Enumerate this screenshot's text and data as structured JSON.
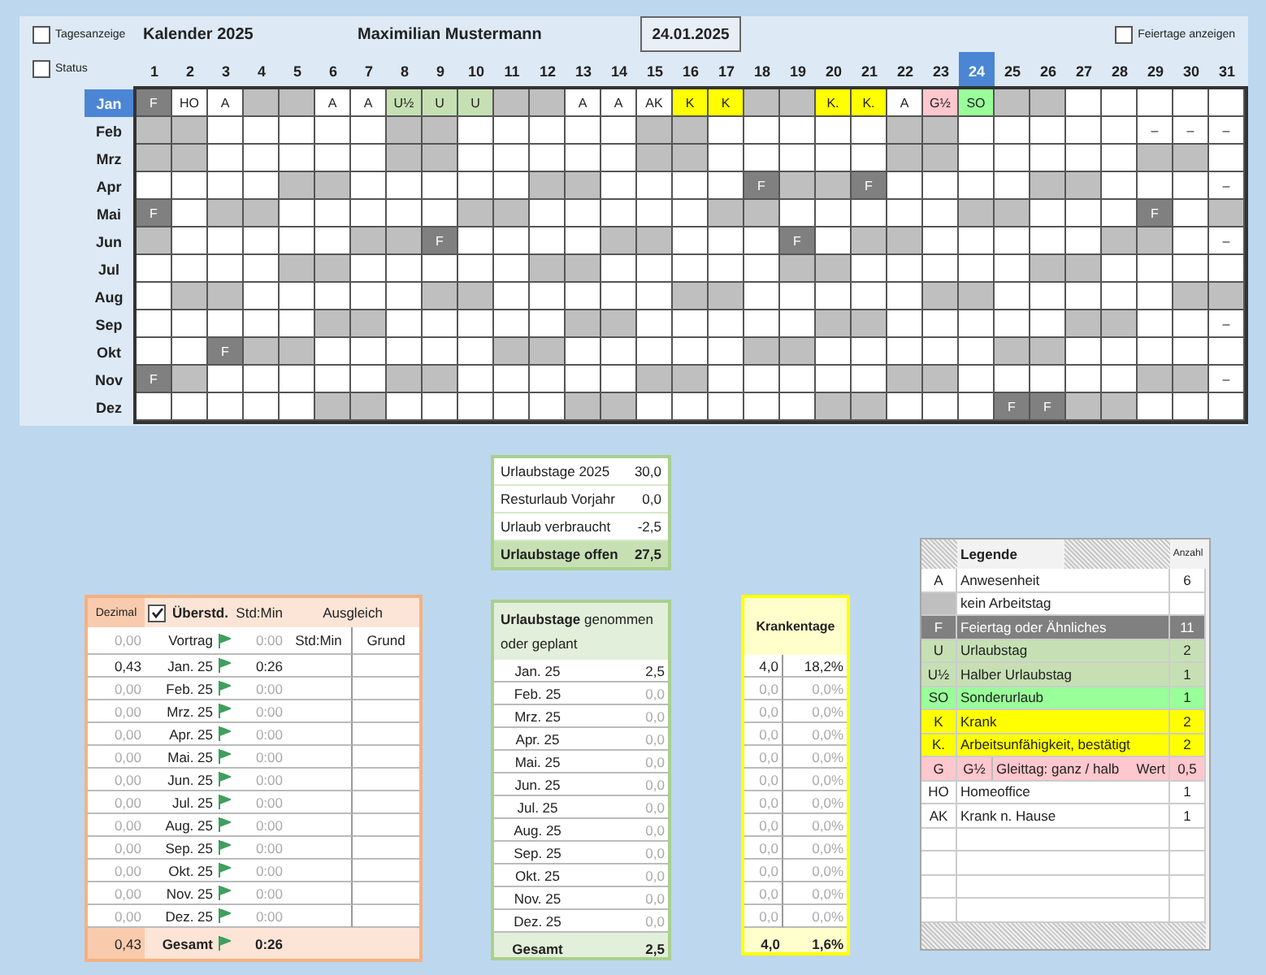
{
  "header": {
    "day_view": {
      "label": "Tagesanzeige",
      "checked": false
    },
    "title": "Kalender 2025",
    "person": "Maximilian Mustermann",
    "date": "24.01.2025",
    "holidays_toggle": {
      "label": "Feiertage anzeigen",
      "checked": false
    },
    "status": {
      "label": "Status",
      "checked": false
    }
  },
  "calendar": {
    "days": [
      {
        "label": "1",
        "selected": false
      },
      {
        "label": "2",
        "selected": false
      },
      {
        "label": "3",
        "selected": false
      },
      {
        "label": "4",
        "selected": false
      },
      {
        "label": "5",
        "selected": false
      },
      {
        "label": "6",
        "selected": false
      },
      {
        "label": "7",
        "selected": false
      },
      {
        "label": "8",
        "selected": false
      },
      {
        "label": "9",
        "selected": false
      },
      {
        "label": "10",
        "selected": false
      },
      {
        "label": "11",
        "selected": false
      },
      {
        "label": "12",
        "selected": false
      },
      {
        "label": "13",
        "selected": false
      },
      {
        "label": "14",
        "selected": false
      },
      {
        "label": "15",
        "selected": false
      },
      {
        "label": "16",
        "selected": false
      },
      {
        "label": "17",
        "selected": false
      },
      {
        "label": "18",
        "selected": false
      },
      {
        "label": "19",
        "selected": false
      },
      {
        "label": "20",
        "selected": false
      },
      {
        "label": "21",
        "selected": false
      },
      {
        "label": "22",
        "selected": false
      },
      {
        "label": "23",
        "selected": false
      },
      {
        "label": "24",
        "selected": true
      },
      {
        "label": "25",
        "selected": false
      },
      {
        "label": "26",
        "selected": false
      },
      {
        "label": "27",
        "selected": false
      },
      {
        "label": "28",
        "selected": false
      },
      {
        "label": "29",
        "selected": false
      },
      {
        "label": "30",
        "selected": false
      },
      {
        "label": "31",
        "selected": false
      }
    ],
    "months": [
      {
        "label": "Jan",
        "selected": true,
        "cells": [
          {
            "kind": "holiday",
            "text": "F"
          },
          {
            "kind": "work",
            "text": "HO"
          },
          {
            "kind": "work",
            "text": "A"
          },
          {
            "kind": "off"
          },
          {
            "kind": "off"
          },
          {
            "kind": "work",
            "text": "A"
          },
          {
            "kind": "work",
            "text": "A"
          },
          {
            "kind": "vacation",
            "text": "U½"
          },
          {
            "kind": "vacation",
            "text": "U"
          },
          {
            "kind": "vacation",
            "text": "U"
          },
          {
            "kind": "off"
          },
          {
            "kind": "off"
          },
          {
            "kind": "work",
            "text": "A"
          },
          {
            "kind": "work",
            "text": "A"
          },
          {
            "kind": "work",
            "text": "AK"
          },
          {
            "kind": "sick",
            "text": "K"
          },
          {
            "kind": "sick",
            "text": "K"
          },
          {
            "kind": "off"
          },
          {
            "kind": "off"
          },
          {
            "kind": "sick",
            "text": "K."
          },
          {
            "kind": "sick",
            "text": "K."
          },
          {
            "kind": "work",
            "text": "A"
          },
          {
            "kind": "flex",
            "text": "G½"
          },
          {
            "kind": "special",
            "text": "SO"
          },
          {
            "kind": "off"
          },
          {
            "kind": "off"
          },
          {
            "kind": "work"
          },
          {
            "kind": "work"
          },
          {
            "kind": "work"
          },
          {
            "kind": "work"
          },
          {
            "kind": "work"
          }
        ]
      },
      {
        "label": "Feb",
        "selected": false,
        "cells": [
          {
            "kind": "off"
          },
          {
            "kind": "off"
          },
          {
            "kind": "work"
          },
          {
            "kind": "work"
          },
          {
            "kind": "work"
          },
          {
            "kind": "work"
          },
          {
            "kind": "work"
          },
          {
            "kind": "off"
          },
          {
            "kind": "off"
          },
          {
            "kind": "work"
          },
          {
            "kind": "work"
          },
          {
            "kind": "work"
          },
          {
            "kind": "work"
          },
          {
            "kind": "work"
          },
          {
            "kind": "off"
          },
          {
            "kind": "off"
          },
          {
            "kind": "work"
          },
          {
            "kind": "work"
          },
          {
            "kind": "work"
          },
          {
            "kind": "work"
          },
          {
            "kind": "work"
          },
          {
            "kind": "off"
          },
          {
            "kind": "off"
          },
          {
            "kind": "work"
          },
          {
            "kind": "work"
          },
          {
            "kind": "work"
          },
          {
            "kind": "work"
          },
          {
            "kind": "work"
          },
          {
            "kind": "none",
            "text": "–"
          },
          {
            "kind": "none",
            "text": "–"
          },
          {
            "kind": "none",
            "text": "–"
          }
        ]
      },
      {
        "label": "Mrz",
        "selected": false,
        "cells": [
          {
            "kind": "off"
          },
          {
            "kind": "off"
          },
          {
            "kind": "work"
          },
          {
            "kind": "work"
          },
          {
            "kind": "work"
          },
          {
            "kind": "work"
          },
          {
            "kind": "work"
          },
          {
            "kind": "off"
          },
          {
            "kind": "off"
          },
          {
            "kind": "work"
          },
          {
            "kind": "work"
          },
          {
            "kind": "work"
          },
          {
            "kind": "work"
          },
          {
            "kind": "work"
          },
          {
            "kind": "off"
          },
          {
            "kind": "off"
          },
          {
            "kind": "work"
          },
          {
            "kind": "work"
          },
          {
            "kind": "work"
          },
          {
            "kind": "work"
          },
          {
            "kind": "work"
          },
          {
            "kind": "off"
          },
          {
            "kind": "off"
          },
          {
            "kind": "work"
          },
          {
            "kind": "work"
          },
          {
            "kind": "work"
          },
          {
            "kind": "work"
          },
          {
            "kind": "work"
          },
          {
            "kind": "off"
          },
          {
            "kind": "off"
          },
          {
            "kind": "work"
          }
        ]
      },
      {
        "label": "Apr",
        "selected": false,
        "cells": [
          {
            "kind": "work"
          },
          {
            "kind": "work"
          },
          {
            "kind": "work"
          },
          {
            "kind": "work"
          },
          {
            "kind": "off"
          },
          {
            "kind": "off"
          },
          {
            "kind": "work"
          },
          {
            "kind": "work"
          },
          {
            "kind": "work"
          },
          {
            "kind": "work"
          },
          {
            "kind": "work"
          },
          {
            "kind": "off"
          },
          {
            "kind": "off"
          },
          {
            "kind": "work"
          },
          {
            "kind": "work"
          },
          {
            "kind": "work"
          },
          {
            "kind": "work"
          },
          {
            "kind": "holiday",
            "text": "F"
          },
          {
            "kind": "off"
          },
          {
            "kind": "off"
          },
          {
            "kind": "holiday",
            "text": "F"
          },
          {
            "kind": "work"
          },
          {
            "kind": "work"
          },
          {
            "kind": "work"
          },
          {
            "kind": "work"
          },
          {
            "kind": "off"
          },
          {
            "kind": "off"
          },
          {
            "kind": "work"
          },
          {
            "kind": "work"
          },
          {
            "kind": "work"
          },
          {
            "kind": "none",
            "text": "–"
          }
        ]
      },
      {
        "label": "Mai",
        "selected": false,
        "cells": [
          {
            "kind": "holiday",
            "text": "F"
          },
          {
            "kind": "work"
          },
          {
            "kind": "off"
          },
          {
            "kind": "off"
          },
          {
            "kind": "work"
          },
          {
            "kind": "work"
          },
          {
            "kind": "work"
          },
          {
            "kind": "work"
          },
          {
            "kind": "work"
          },
          {
            "kind": "off"
          },
          {
            "kind": "off"
          },
          {
            "kind": "work"
          },
          {
            "kind": "work"
          },
          {
            "kind": "work"
          },
          {
            "kind": "work"
          },
          {
            "kind": "work"
          },
          {
            "kind": "off"
          },
          {
            "kind": "off"
          },
          {
            "kind": "work"
          },
          {
            "kind": "work"
          },
          {
            "kind": "work"
          },
          {
            "kind": "work"
          },
          {
            "kind": "work"
          },
          {
            "kind": "off"
          },
          {
            "kind": "off"
          },
          {
            "kind": "work"
          },
          {
            "kind": "work"
          },
          {
            "kind": "work"
          },
          {
            "kind": "holiday",
            "text": "F"
          },
          {
            "kind": "work"
          },
          {
            "kind": "off"
          }
        ]
      },
      {
        "label": "Jun",
        "selected": false,
        "cells": [
          {
            "kind": "off"
          },
          {
            "kind": "work"
          },
          {
            "kind": "work"
          },
          {
            "kind": "work"
          },
          {
            "kind": "work"
          },
          {
            "kind": "work"
          },
          {
            "kind": "off"
          },
          {
            "kind": "off"
          },
          {
            "kind": "holiday",
            "text": "F"
          },
          {
            "kind": "work"
          },
          {
            "kind": "work"
          },
          {
            "kind": "work"
          },
          {
            "kind": "work"
          },
          {
            "kind": "off"
          },
          {
            "kind": "off"
          },
          {
            "kind": "work"
          },
          {
            "kind": "work"
          },
          {
            "kind": "work"
          },
          {
            "kind": "holiday",
            "text": "F"
          },
          {
            "kind": "work"
          },
          {
            "kind": "off"
          },
          {
            "kind": "off"
          },
          {
            "kind": "work"
          },
          {
            "kind": "work"
          },
          {
            "kind": "work"
          },
          {
            "kind": "work"
          },
          {
            "kind": "work"
          },
          {
            "kind": "off"
          },
          {
            "kind": "off"
          },
          {
            "kind": "work"
          },
          {
            "kind": "none",
            "text": "–"
          }
        ]
      },
      {
        "label": "Jul",
        "selected": false,
        "cells": [
          {
            "kind": "work"
          },
          {
            "kind": "work"
          },
          {
            "kind": "work"
          },
          {
            "kind": "work"
          },
          {
            "kind": "off"
          },
          {
            "kind": "off"
          },
          {
            "kind": "work"
          },
          {
            "kind": "work"
          },
          {
            "kind": "work"
          },
          {
            "kind": "work"
          },
          {
            "kind": "work"
          },
          {
            "kind": "off"
          },
          {
            "kind": "off"
          },
          {
            "kind": "work"
          },
          {
            "kind": "work"
          },
          {
            "kind": "work"
          },
          {
            "kind": "work"
          },
          {
            "kind": "work"
          },
          {
            "kind": "off"
          },
          {
            "kind": "off"
          },
          {
            "kind": "work"
          },
          {
            "kind": "work"
          },
          {
            "kind": "work"
          },
          {
            "kind": "work"
          },
          {
            "kind": "work"
          },
          {
            "kind": "off"
          },
          {
            "kind": "off"
          },
          {
            "kind": "work"
          },
          {
            "kind": "work"
          },
          {
            "kind": "work"
          },
          {
            "kind": "work"
          }
        ]
      },
      {
        "label": "Aug",
        "selected": false,
        "cells": [
          {
            "kind": "work"
          },
          {
            "kind": "off"
          },
          {
            "kind": "off"
          },
          {
            "kind": "work"
          },
          {
            "kind": "work"
          },
          {
            "kind": "work"
          },
          {
            "kind": "work"
          },
          {
            "kind": "work"
          },
          {
            "kind": "off"
          },
          {
            "kind": "off"
          },
          {
            "kind": "work"
          },
          {
            "kind": "work"
          },
          {
            "kind": "work"
          },
          {
            "kind": "work"
          },
          {
            "kind": "work"
          },
          {
            "kind": "off"
          },
          {
            "kind": "off"
          },
          {
            "kind": "work"
          },
          {
            "kind": "work"
          },
          {
            "kind": "work"
          },
          {
            "kind": "work"
          },
          {
            "kind": "work"
          },
          {
            "kind": "off"
          },
          {
            "kind": "off"
          },
          {
            "kind": "work"
          },
          {
            "kind": "work"
          },
          {
            "kind": "work"
          },
          {
            "kind": "work"
          },
          {
            "kind": "work"
          },
          {
            "kind": "off"
          },
          {
            "kind": "off"
          }
        ]
      },
      {
        "label": "Sep",
        "selected": false,
        "cells": [
          {
            "kind": "work"
          },
          {
            "kind": "work"
          },
          {
            "kind": "work"
          },
          {
            "kind": "work"
          },
          {
            "kind": "work"
          },
          {
            "kind": "off"
          },
          {
            "kind": "off"
          },
          {
            "kind": "work"
          },
          {
            "kind": "work"
          },
          {
            "kind": "work"
          },
          {
            "kind": "work"
          },
          {
            "kind": "work"
          },
          {
            "kind": "off"
          },
          {
            "kind": "off"
          },
          {
            "kind": "work"
          },
          {
            "kind": "work"
          },
          {
            "kind": "work"
          },
          {
            "kind": "work"
          },
          {
            "kind": "work"
          },
          {
            "kind": "off"
          },
          {
            "kind": "off"
          },
          {
            "kind": "work"
          },
          {
            "kind": "work"
          },
          {
            "kind": "work"
          },
          {
            "kind": "work"
          },
          {
            "kind": "work"
          },
          {
            "kind": "off"
          },
          {
            "kind": "off"
          },
          {
            "kind": "work"
          },
          {
            "kind": "work"
          },
          {
            "kind": "none",
            "text": "–"
          }
        ]
      },
      {
        "label": "Okt",
        "selected": false,
        "cells": [
          {
            "kind": "work"
          },
          {
            "kind": "work"
          },
          {
            "kind": "holiday",
            "text": "F"
          },
          {
            "kind": "off"
          },
          {
            "kind": "off"
          },
          {
            "kind": "work"
          },
          {
            "kind": "work"
          },
          {
            "kind": "work"
          },
          {
            "kind": "work"
          },
          {
            "kind": "work"
          },
          {
            "kind": "off"
          },
          {
            "kind": "off"
          },
          {
            "kind": "work"
          },
          {
            "kind": "work"
          },
          {
            "kind": "work"
          },
          {
            "kind": "work"
          },
          {
            "kind": "work"
          },
          {
            "kind": "off"
          },
          {
            "kind": "off"
          },
          {
            "kind": "work"
          },
          {
            "kind": "work"
          },
          {
            "kind": "work"
          },
          {
            "kind": "work"
          },
          {
            "kind": "work"
          },
          {
            "kind": "off"
          },
          {
            "kind": "off"
          },
          {
            "kind": "work"
          },
          {
            "kind": "work"
          },
          {
            "kind": "work"
          },
          {
            "kind": "work"
          },
          {
            "kind": "work"
          }
        ]
      },
      {
        "label": "Nov",
        "selected": false,
        "cells": [
          {
            "kind": "holiday",
            "text": "F"
          },
          {
            "kind": "off"
          },
          {
            "kind": "work"
          },
          {
            "kind": "work"
          },
          {
            "kind": "work"
          },
          {
            "kind": "work"
          },
          {
            "kind": "work"
          },
          {
            "kind": "off"
          },
          {
            "kind": "off"
          },
          {
            "kind": "work"
          },
          {
            "kind": "work"
          },
          {
            "kind": "work"
          },
          {
            "kind": "work"
          },
          {
            "kind": "work"
          },
          {
            "kind": "off"
          },
          {
            "kind": "off"
          },
          {
            "kind": "work"
          },
          {
            "kind": "work"
          },
          {
            "kind": "work"
          },
          {
            "kind": "work"
          },
          {
            "kind": "work"
          },
          {
            "kind": "off"
          },
          {
            "kind": "off"
          },
          {
            "kind": "work"
          },
          {
            "kind": "work"
          },
          {
            "kind": "work"
          },
          {
            "kind": "work"
          },
          {
            "kind": "work"
          },
          {
            "kind": "off"
          },
          {
            "kind": "off"
          },
          {
            "kind": "none",
            "text": "–"
          }
        ]
      },
      {
        "label": "Dez",
        "selected": false,
        "cells": [
          {
            "kind": "work"
          },
          {
            "kind": "work"
          },
          {
            "kind": "work"
          },
          {
            "kind": "work"
          },
          {
            "kind": "work"
          },
          {
            "kind": "off"
          },
          {
            "kind": "off"
          },
          {
            "kind": "work"
          },
          {
            "kind": "work"
          },
          {
            "kind": "work"
          },
          {
            "kind": "work"
          },
          {
            "kind": "work"
          },
          {
            "kind": "off"
          },
          {
            "kind": "off"
          },
          {
            "kind": "work"
          },
          {
            "kind": "work"
          },
          {
            "kind": "work"
          },
          {
            "kind": "work"
          },
          {
            "kind": "work"
          },
          {
            "kind": "off"
          },
          {
            "kind": "off"
          },
          {
            "kind": "work"
          },
          {
            "kind": "work"
          },
          {
            "kind": "work"
          },
          {
            "kind": "holiday",
            "text": "F"
          },
          {
            "kind": "holiday",
            "text": "F"
          },
          {
            "kind": "off"
          },
          {
            "kind": "off"
          },
          {
            "kind": "work"
          },
          {
            "kind": "work"
          },
          {
            "kind": "work"
          }
        ]
      }
    ]
  },
  "overtime": {
    "decimal_header": "Dezimal",
    "checkbox": {
      "label": "Überstd.",
      "checked": true
    },
    "time_header": "Std:Min",
    "compensation_header": "Ausgleich",
    "compensation_columns": [
      "Std:Min",
      "Grund"
    ],
    "carryover": {
      "decimal": "0,00",
      "label": "Vortrag",
      "time": "0:00",
      "dimmed": true
    },
    "rows": [
      {
        "decimal": "0,43",
        "month": "Jan. 25",
        "time": "0:26",
        "dimmed": false
      },
      {
        "decimal": "0,00",
        "month": "Feb. 25",
        "time": "0:00",
        "dimmed": true
      },
      {
        "decimal": "0,00",
        "month": "Mrz. 25",
        "time": "0:00",
        "dimmed": true
      },
      {
        "decimal": "0,00",
        "month": "Apr. 25",
        "time": "0:00",
        "dimmed": true
      },
      {
        "decimal": "0,00",
        "month": "Mai. 25",
        "time": "0:00",
        "dimmed": true
      },
      {
        "decimal": "0,00",
        "month": "Jun. 25",
        "time": "0:00",
        "dimmed": true
      },
      {
        "decimal": "0,00",
        "month": "Jul. 25",
        "time": "0:00",
        "dimmed": true
      },
      {
        "decimal": "0,00",
        "month": "Aug. 25",
        "time": "0:00",
        "dimmed": true
      },
      {
        "decimal": "0,00",
        "month": "Sep. 25",
        "time": "0:00",
        "dimmed": true
      },
      {
        "decimal": "0,00",
        "month": "Okt. 25",
        "time": "0:00",
        "dimmed": true
      },
      {
        "decimal": "0,00",
        "month": "Nov. 25",
        "time": "0:00",
        "dimmed": true
      },
      {
        "decimal": "0,00",
        "month": "Dez. 25",
        "time": "0:00",
        "dimmed": true
      }
    ],
    "total": {
      "decimal": "0,43",
      "label": "Gesamt",
      "time": "0:26"
    }
  },
  "summary": {
    "rows": [
      {
        "label": "Urlaubstage 2025",
        "value": "30,0",
        "total": false
      },
      {
        "label": "Resturlaub Vorjahr",
        "value": "0,0",
        "total": false
      },
      {
        "label": "Urlaub verbraucht",
        "value": "-2,5",
        "total": false
      },
      {
        "label": "Urlaubstage offen",
        "value": "27,5",
        "total": true
      }
    ]
  },
  "vacation": {
    "title": "**Urlaubstage** genommen oder geplant",
    "rows": [
      {
        "month": "Jan. 25",
        "value": "2,5",
        "dimmed": false
      },
      {
        "month": "Feb. 25",
        "value": "0,0",
        "dimmed": true
      },
      {
        "month": "Mrz. 25",
        "value": "0,0",
        "dimmed": true
      },
      {
        "month": "Apr. 25",
        "value": "0,0",
        "dimmed": true
      },
      {
        "month": "Mai. 25",
        "value": "0,0",
        "dimmed": true
      },
      {
        "month": "Jun. 25",
        "value": "0,0",
        "dimmed": true
      },
      {
        "month": "Jul. 25",
        "value": "0,0",
        "dimmed": true
      },
      {
        "month": "Aug. 25",
        "value": "0,0",
        "dimmed": true
      },
      {
        "month": "Sep. 25",
        "value": "0,0",
        "dimmed": true
      },
      {
        "month": "Okt. 25",
        "value": "0,0",
        "dimmed": true
      },
      {
        "month": "Nov. 25",
        "value": "0,0",
        "dimmed": true
      },
      {
        "month": "Dez. 25",
        "value": "0,0",
        "dimmed": true
      }
    ],
    "total": {
      "label": "Gesamt",
      "value": "2,5"
    }
  },
  "sick": {
    "title": "Krankentage",
    "rows": [
      {
        "days": "4,0",
        "percent": "18,2%",
        "dimmed": false
      },
      {
        "days": "0,0",
        "percent": "0,0%",
        "dimmed": true
      },
      {
        "days": "0,0",
        "percent": "0,0%",
        "dimmed": true
      },
      {
        "days": "0,0",
        "percent": "0,0%",
        "dimmed": true
      },
      {
        "days": "0,0",
        "percent": "0,0%",
        "dimmed": true
      },
      {
        "days": "0,0",
        "percent": "0,0%",
        "dimmed": true
      },
      {
        "days": "0,0",
        "percent": "0,0%",
        "dimmed": true
      },
      {
        "days": "0,0",
        "percent": "0,0%",
        "dimmed": true
      },
      {
        "days": "0,0",
        "percent": "0,0%",
        "dimmed": true
      },
      {
        "days": "0,0",
        "percent": "0,0%",
        "dimmed": true
      },
      {
        "days": "0,0",
        "percent": "0,0%",
        "dimmed": true
      },
      {
        "days": "0,0",
        "percent": "0,0%",
        "dimmed": true
      }
    ],
    "total": {
      "days": "4,0",
      "percent": "1,6%"
    }
  },
  "legend": {
    "title": "Legende",
    "count_header": "Anzahl",
    "items": [
      {
        "code": "A",
        "kind": "work",
        "label": "Anwesenheit",
        "count": "6"
      },
      {
        "kind": "off",
        "label": "kein Arbeitstag"
      },
      {
        "code": "F",
        "kind": "holiday",
        "label": "Feiertag oder Ähnliches",
        "count": "11"
      },
      {
        "code": "U",
        "kind": "vacation",
        "label": "Urlaubstag",
        "count": "2"
      },
      {
        "code": "U½",
        "kind": "vacation",
        "label": "Halber Urlaubstag",
        "count": "1"
      },
      {
        "code": "SO",
        "kind": "special",
        "label": "Sonderurlaub",
        "count": "1"
      },
      {
        "code": "K",
        "kind": "sick",
        "label": "Krank",
        "count": "2"
      },
      {
        "code": "K.",
        "kind": "sick",
        "label": "Arbeitsunfähigkeit, bestätigt",
        "count": "2"
      },
      {
        "code": "G",
        "code_half": "G½",
        "kind": "flex",
        "label": "Gleittag: ganz / halb",
        "value_label": "Wert",
        "count": "0,5"
      },
      {
        "code": "HO",
        "kind": "work",
        "label": "Homeoffice",
        "count": "1"
      },
      {
        "code": "AK",
        "kind": "work",
        "label": "Krank n. Hause",
        "count": "1"
      }
    ]
  }
}
